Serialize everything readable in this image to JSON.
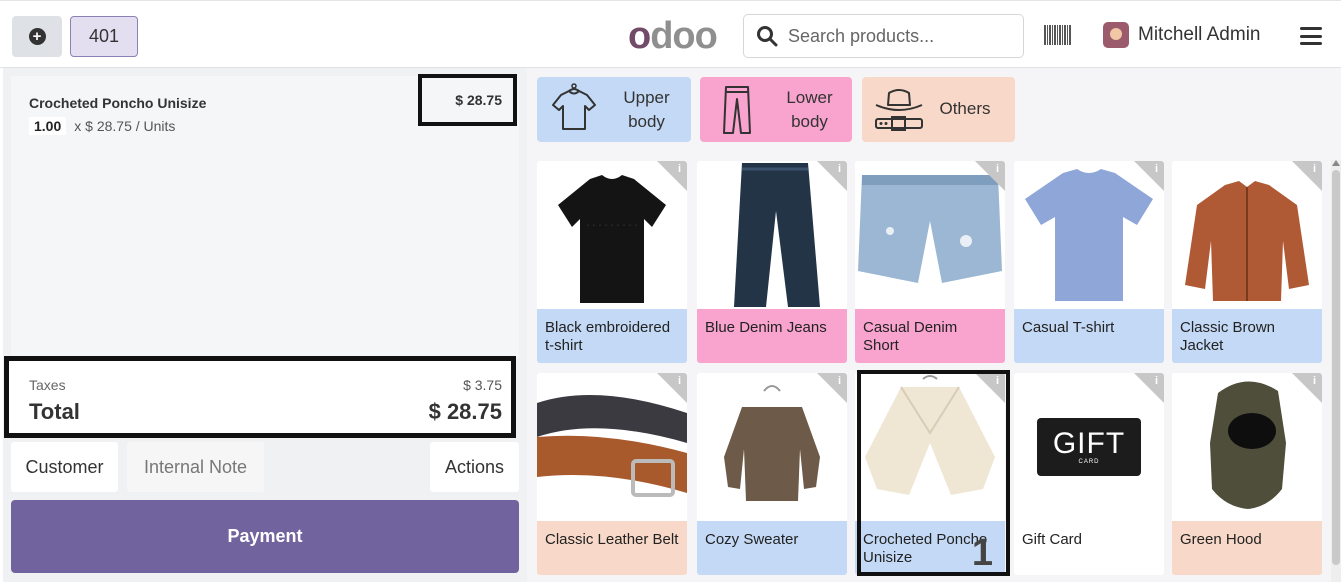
{
  "header": {
    "new_order_icon": "plus-circle-icon",
    "order_number": "401",
    "logo_first": "o",
    "logo_rest": "doo",
    "search_placeholder": "Search products...",
    "barcode_icon": "barcode-icon",
    "user_name": "Mitchell Admin",
    "menu_icon": "hamburger-menu-icon"
  },
  "order": {
    "lines": [
      {
        "product": "Crocheted Poncho Unisize",
        "qty": "1.00",
        "unit_price": "x $ 28.75 / Units",
        "price": "$ 28.75"
      }
    ],
    "taxes_label": "Taxes",
    "taxes_value": "$ 3.75",
    "total_label": "Total",
    "total_value": "$ 28.75"
  },
  "controls": {
    "customer": "Customer",
    "internal_note": "Internal Note",
    "actions": "Actions",
    "payment": "Payment"
  },
  "categories": [
    {
      "label": "Upper body",
      "icon": "shirt-icon",
      "color": "#c3d9f5"
    },
    {
      "label": "Lower body",
      "icon": "pants-icon",
      "color": "#f8a4ce"
    },
    {
      "label": "Others",
      "icon": "hat-belt-icon",
      "color": "#f8d8c8"
    }
  ],
  "products": [
    {
      "name": "Black embroidered t-shirt",
      "color": "#c3d9f5"
    },
    {
      "name": "Blue Denim Jeans",
      "color": "#f8a4ce"
    },
    {
      "name": "Casual Denim Short",
      "color": "#f8a4ce"
    },
    {
      "name": "Casual T-shirt",
      "color": "#c3d9f5"
    },
    {
      "name": "Classic Brown Jacket",
      "color": "#c3d9f5"
    },
    {
      "name": "Classic Leather Belt",
      "color": "#f8d8c8"
    },
    {
      "name": "Cozy Sweater",
      "color": "#c3d9f5"
    },
    {
      "name": "Crocheted Poncho Unisize",
      "color": "#c3d9f5",
      "qty_in_cart": "1"
    },
    {
      "name": "Gift Card",
      "color": "#ffffff"
    },
    {
      "name": "Green Hood",
      "color": "#f8d8c8"
    }
  ],
  "product_info_icon": "i",
  "gift_card_text": "GIFT",
  "gift_card_subtext": "CARD"
}
